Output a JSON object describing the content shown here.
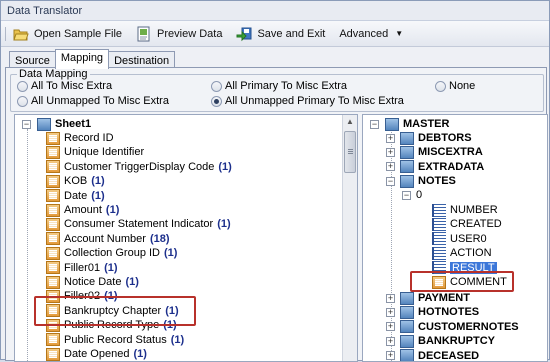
{
  "window": {
    "title": "Data Translator"
  },
  "toolbar": {
    "open_sample": "Open Sample File",
    "preview": "Preview Data",
    "save_exit": "Save and Exit",
    "advanced": "Advanced"
  },
  "tabs": [
    "Source",
    "Mapping",
    "Destination"
  ],
  "mapping_group": {
    "title": "Data Mapping",
    "options": {
      "all_to_misc": "All To Misc Extra",
      "all_primary_to_misc": "All Primary To Misc Extra",
      "none": "None",
      "all_unmapped_to_misc": "All Unmapped To Misc Extra",
      "all_unmapped_primary_to_misc": "All Unmapped Primary To Misc Extra"
    },
    "selected": "all_unmapped_primary_to_misc"
  },
  "source_tree": {
    "root": "Sheet1",
    "fields": [
      {
        "label": "Record ID",
        "count": ""
      },
      {
        "label": "Unique Identifier",
        "count": ""
      },
      {
        "label": "Customer TriggerDisplay Code",
        "count": "(1)"
      },
      {
        "label": "KOB",
        "count": "(1)"
      },
      {
        "label": "Date",
        "count": "(1)"
      },
      {
        "label": "Amount",
        "count": "(1)"
      },
      {
        "label": "Consumer Statement Indicator",
        "count": "(1)"
      },
      {
        "label": "Account Number",
        "count": "(18)"
      },
      {
        "label": "Collection Group ID",
        "count": "(1)"
      },
      {
        "label": "Filler01",
        "count": "(1)"
      },
      {
        "label": "Notice Date",
        "count": "(1)"
      },
      {
        "label": "Filler02",
        "count": "(1)"
      },
      {
        "label": "Bankruptcy Chapter",
        "count": "(1)"
      },
      {
        "label": "Public Record Type",
        "count": "(1)"
      },
      {
        "label": "Public Record Status",
        "count": "(1)"
      },
      {
        "label": "Date Opened",
        "count": "(1)"
      }
    ]
  },
  "dest_tree": {
    "root": "MASTER",
    "groups_top": [
      "DEBTORS",
      "MISCEXTRA",
      "EXTRADATA",
      "NOTES"
    ],
    "notes_index": "0",
    "notes_fields": [
      "NUMBER",
      "CREATED",
      "USER0",
      "ACTION",
      "RESULT",
      "COMMENT"
    ],
    "selected_field": "RESULT",
    "groups_bottom": [
      "PAYMENT",
      "HOTNOTES",
      "CUSTOMERNOTES",
      "BANKRUPTCY",
      "DECEASED"
    ]
  },
  "colors": {
    "highlight": "#b8312b",
    "selection": "#3c77d9",
    "count": "#1c2f8c"
  }
}
